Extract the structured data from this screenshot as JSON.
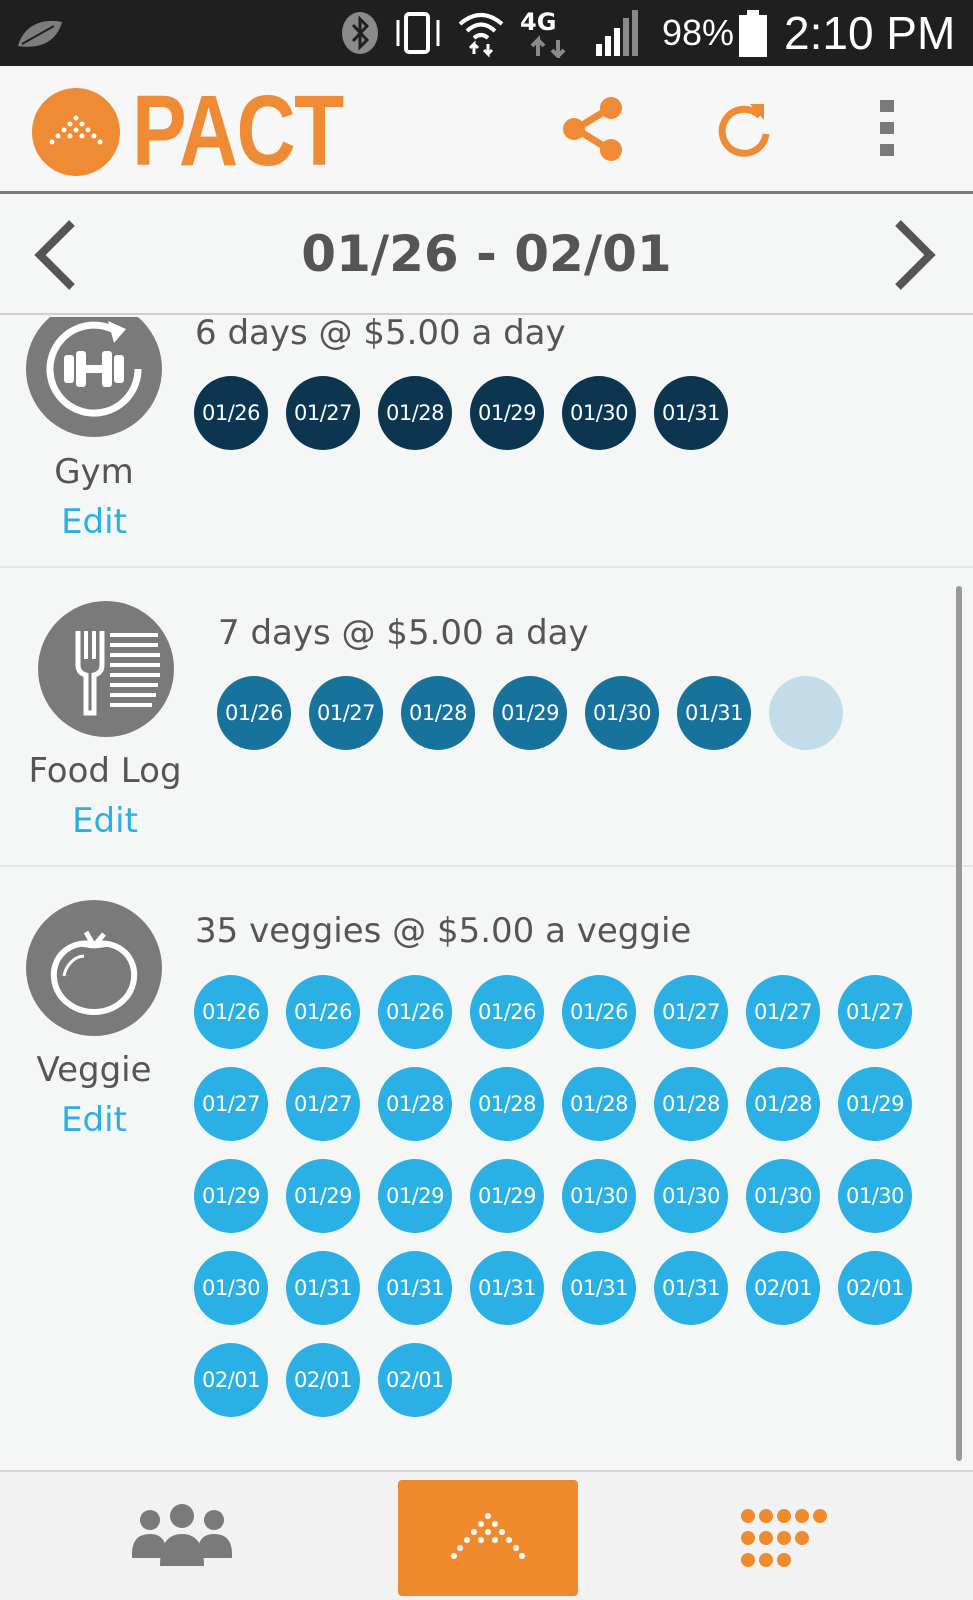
{
  "status_bar": {
    "battery": "98%",
    "time": "2:10 PM"
  },
  "app_bar": {
    "logo_text": "PACT"
  },
  "week": {
    "range": "01/26 - 02/01"
  },
  "pacts": [
    {
      "name": "Gym",
      "edit_label": "Edit",
      "summary": "6 days @ $5.00 a day",
      "dates": [
        "01/26",
        "01/27",
        "01/28",
        "01/29",
        "01/30",
        "01/31"
      ]
    },
    {
      "name": "Food Log",
      "edit_label": "Edit",
      "summary": "7 days @ $5.00 a day",
      "dates": [
        "01/26",
        "01/27",
        "01/28",
        "01/29",
        "01/30",
        "01/31",
        ""
      ]
    },
    {
      "name": "Veggie",
      "edit_label": "Edit",
      "summary": "35 veggies @ $5.00 a veggie",
      "dates": [
        "01/26",
        "01/26",
        "01/26",
        "01/26",
        "01/26",
        "01/27",
        "01/27",
        "01/27",
        "01/27",
        "01/27",
        "01/28",
        "01/28",
        "01/28",
        "01/28",
        "01/28",
        "01/29",
        "01/29",
        "01/29",
        "01/29",
        "01/29",
        "01/30",
        "01/30",
        "01/30",
        "01/30",
        "01/30",
        "01/31",
        "01/31",
        "01/31",
        "01/31",
        "01/31",
        "02/01",
        "02/01",
        "02/01",
        "02/01",
        "02/01"
      ]
    }
  ],
  "colors": {
    "brand_orange": "#ef8a35",
    "gym_dot": "#0c3550",
    "food_dot": "#17739c",
    "veggie_dot": "#2bb0e6",
    "empty_dot": "#c2dde8",
    "edit_link": "#2bb0e6"
  },
  "icons": {
    "gym": "dumbbell-icon",
    "food": "fork-list-icon",
    "veggie": "tomato-icon",
    "share": "share-icon",
    "refresh": "refresh-icon",
    "menu": "overflow-menu-icon",
    "community": "group-icon",
    "pacts": "pact-logo-icon",
    "more": "dots-grid-icon"
  }
}
